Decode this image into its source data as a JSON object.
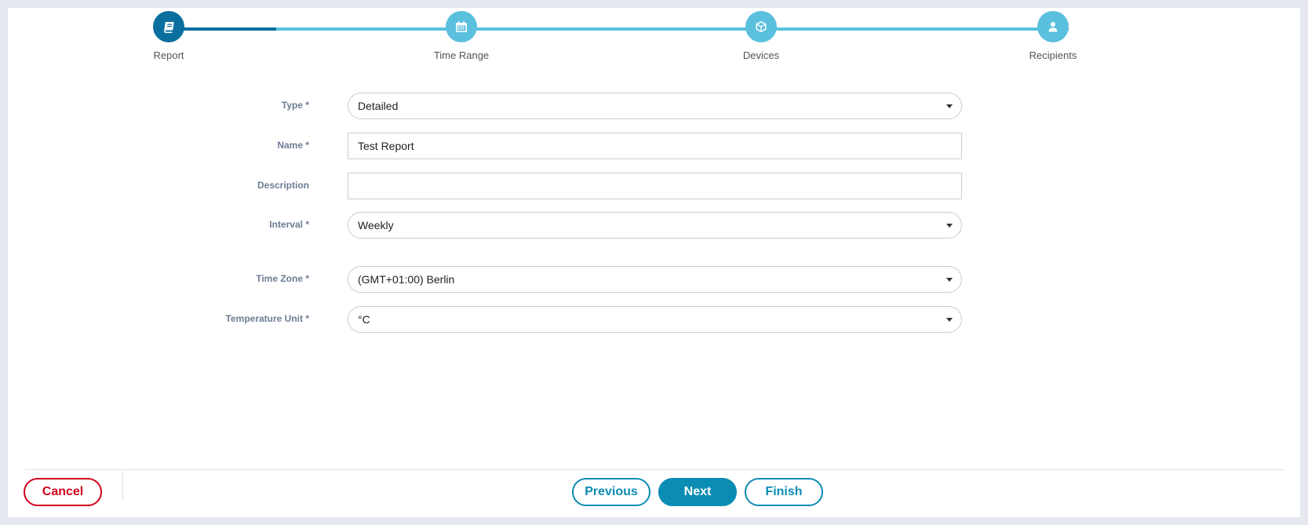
{
  "stepper": {
    "steps": [
      {
        "label": "Report",
        "icon": "book-icon",
        "state": "active"
      },
      {
        "label": "Time Range",
        "icon": "calendar-icon",
        "state": "pending"
      },
      {
        "label": "Devices",
        "icon": "cube-icon",
        "state": "pending"
      },
      {
        "label": "Recipients",
        "icon": "user-icon",
        "state": "pending"
      }
    ],
    "colors": {
      "active": "#0b6f9e",
      "pending": "#5bc0de"
    }
  },
  "form": {
    "type": {
      "label": "Type *",
      "value": "Detailed"
    },
    "name": {
      "label": "Name *",
      "value": "Test Report"
    },
    "description": {
      "label": "Description",
      "value": ""
    },
    "interval": {
      "label": "Interval *",
      "value": "Weekly"
    },
    "time_zone": {
      "label": "Time Zone *",
      "value": "(GMT+01:00) Berlin"
    },
    "temperature_unit": {
      "label": "Temperature Unit *",
      "value": "°C"
    }
  },
  "footer": {
    "cancel_label": "Cancel",
    "previous_label": "Previous",
    "next_label": "Next",
    "finish_label": "Finish",
    "colors": {
      "cancel": "#d0021b",
      "primary": "#0b8cb3"
    }
  }
}
